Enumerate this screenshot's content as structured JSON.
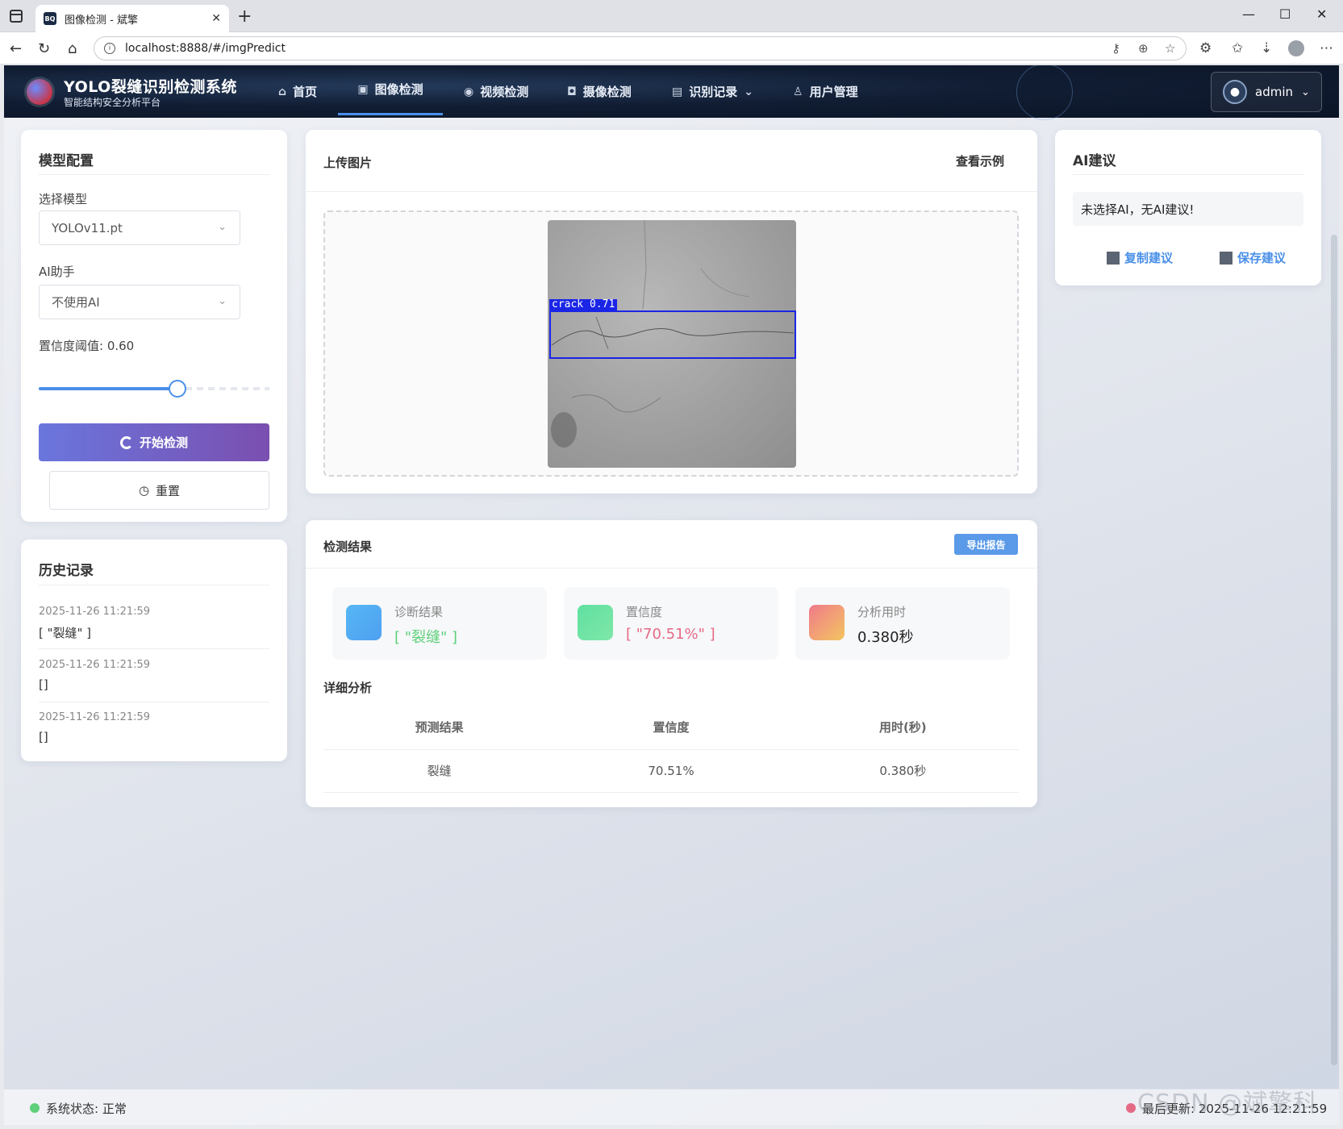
{
  "browser": {
    "tab_title": "图像检测 - 斌擎",
    "tab_icon": "BQ",
    "url": "localhost:8888/#/imgPredict"
  },
  "header": {
    "title": "YOLO裂缝识别检测系统",
    "subtitle": "智能结构安全分析平台",
    "nav": [
      {
        "label": "首页",
        "icon": "home-icon"
      },
      {
        "label": "图像检测",
        "icon": "image-icon",
        "active": true
      },
      {
        "label": "视频检测",
        "icon": "video-icon"
      },
      {
        "label": "摄像检测",
        "icon": "camera-icon"
      },
      {
        "label": "识别记录",
        "icon": "document-icon"
      },
      {
        "label": "用户管理",
        "icon": "user-icon"
      }
    ],
    "user": "admin"
  },
  "config": {
    "title": "模型配置",
    "model_label": "选择模型",
    "model_value": "YOLOv11.pt",
    "ai_label": "AI助手",
    "ai_value": "不使用AI",
    "threshold_label": "置信度阈值: 0.60",
    "threshold": 0.6,
    "start_label": "开始检测",
    "reset_label": "重置"
  },
  "history": {
    "title": "历史记录",
    "items": [
      {
        "time": "2025-11-26 11:21:59",
        "value": "[ \"裂缝\" ]"
      },
      {
        "time": "2025-11-26 11:21:59",
        "value": "[]"
      },
      {
        "time": "2025-11-26 11:21:59",
        "value": "[]"
      }
    ]
  },
  "upload": {
    "title": "上传图片",
    "example_label": "查看示例",
    "detection_label": "crack  0.71"
  },
  "result": {
    "title": "检测结果",
    "export_label": "导出报告",
    "stats": [
      {
        "label": "诊断结果",
        "value": "[ \"裂缝\" ]",
        "color": "#5fd07a"
      },
      {
        "label": "置信度",
        "value": "[ \"70.51%\" ]",
        "color": "#e56a86"
      },
      {
        "label": "分析用时",
        "value": "0.380秒",
        "color": "#222222"
      }
    ],
    "detail_title": "详细分析",
    "table": {
      "headers": [
        "预测结果",
        "置信度",
        "用时(秒)"
      ],
      "rows": [
        [
          "裂缝",
          "70.51%",
          "0.380秒"
        ]
      ]
    }
  },
  "ai": {
    "title": "AI建议",
    "message": "未选择AI，无AI建议!",
    "copy_label": "复制建议",
    "save_label": "保存建议"
  },
  "footer": {
    "status": "系统状态: 正常",
    "updated": "最后更新: 2025-11-26 12:21:59",
    "watermark": "CSDN @斌擎科技"
  },
  "colors": {
    "accent": "#4a8fe8",
    "primary_gradient_start": "#6a76dd",
    "primary_gradient_end": "#7a4fb0",
    "status_ok": "#5fd07a",
    "status_alert": "#e56a86"
  }
}
